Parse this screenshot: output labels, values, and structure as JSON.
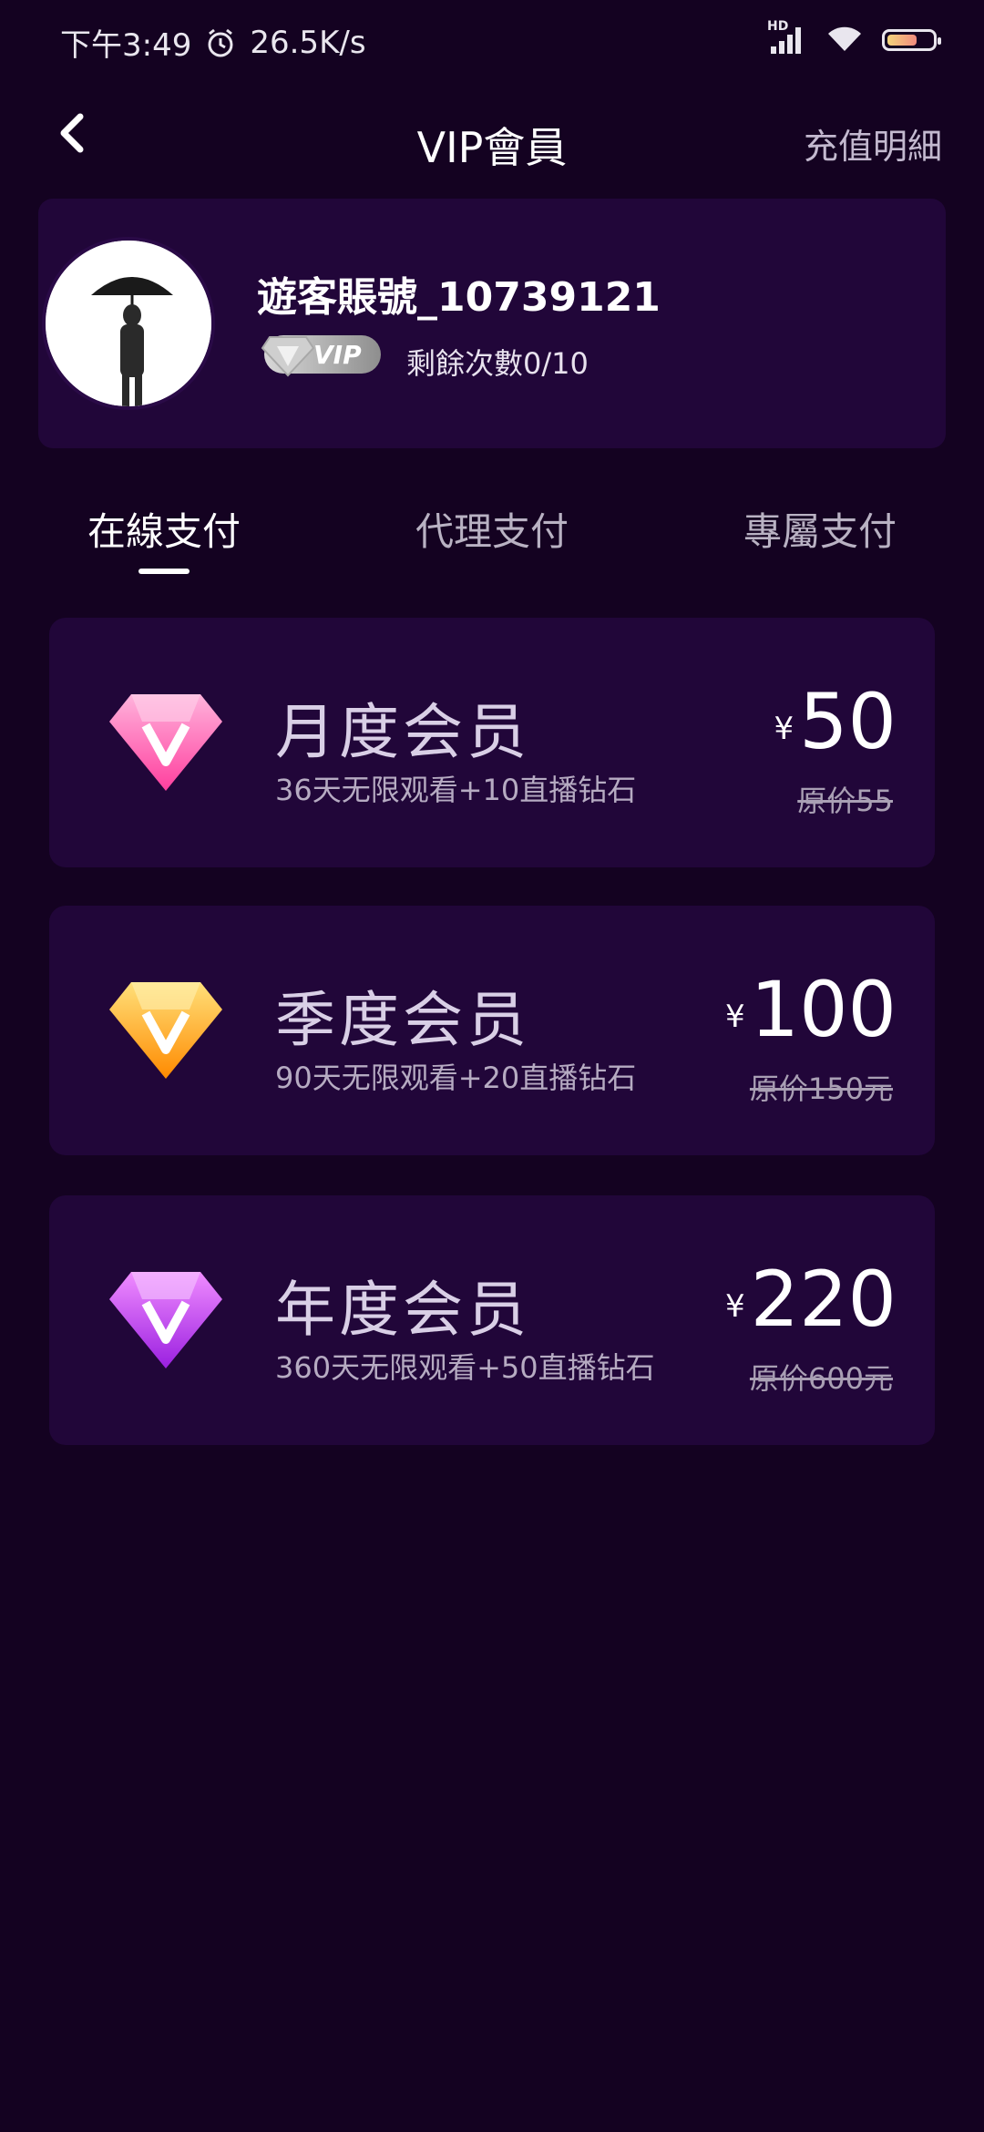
{
  "status_bar": {
    "time": "下午3:49",
    "net_speed": "26.5K/s",
    "hd_label": "HD",
    "battery_level": "60%"
  },
  "header": {
    "title": "VIP會員",
    "recharge_link": "充值明細"
  },
  "profile": {
    "username": "遊客賬號_10739121",
    "vip_badge": "VIP",
    "remaining": "剩餘次數0/10"
  },
  "tabs": [
    {
      "label": "在線支付",
      "active": true
    },
    {
      "label": "代理支付",
      "active": false
    },
    {
      "label": "專屬支付",
      "active": false
    }
  ],
  "plans": [
    {
      "name": "月度会员",
      "desc": "36天无限观看+10直播钻石",
      "currency": "¥",
      "price": "50",
      "original": "原价55",
      "icon": "pink-diamond-icon",
      "color": "#ff5fb3"
    },
    {
      "name": "季度会员",
      "desc": "90天无限观看+20直播钻石",
      "currency": "¥",
      "price": "100",
      "original": "原价150元",
      "icon": "gold-diamond-icon",
      "color": "#ffae1a"
    },
    {
      "name": "年度会员",
      "desc": "360天无限观看+50直播钻石",
      "currency": "¥",
      "price": "220",
      "original": "原价600元",
      "icon": "purple-diamond-icon",
      "color": "#c63cf0"
    }
  ],
  "colors": {
    "background": "#140221",
    "card": "#210639",
    "accent_text": "#d9cfe6"
  }
}
